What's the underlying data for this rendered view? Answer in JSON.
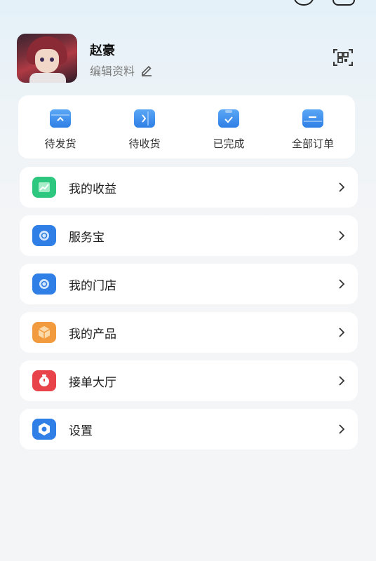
{
  "profile": {
    "name": "赵豪",
    "edit_label": "编辑资料"
  },
  "orders": [
    {
      "label": "待发货",
      "icon": "box-up-icon"
    },
    {
      "label": "待收货",
      "icon": "box-arrow-icon"
    },
    {
      "label": "已完成",
      "icon": "clipboard-check-icon"
    },
    {
      "label": "全部订单",
      "icon": "wallet-icon"
    }
  ],
  "menu": [
    {
      "label": "我的收益",
      "icon": "earnings-chart-icon",
      "color": "#2ec77f"
    },
    {
      "label": "服务宝",
      "icon": "service-icon",
      "color": "#2f7fe6"
    },
    {
      "label": "我的门店",
      "icon": "store-icon",
      "color": "#2f7fe6"
    },
    {
      "label": "我的产品",
      "icon": "product-box-icon",
      "color": "#f19a3e"
    },
    {
      "label": "接单大厅",
      "icon": "timer-icon",
      "color": "#e8424a"
    },
    {
      "label": "设置",
      "icon": "settings-gear-icon",
      "color": "#2f7fe6"
    }
  ],
  "colors": {
    "accent_blue": "#2f7fe6",
    "background": "#f4f5f7"
  }
}
